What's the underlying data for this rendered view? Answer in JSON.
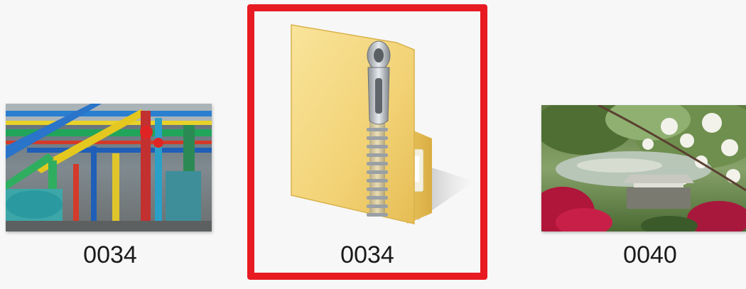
{
  "items": [
    {
      "name": "0034",
      "type": "image",
      "thumbnail": "industrial-pipes-photo"
    },
    {
      "name": "0034",
      "type": "zip-folder",
      "icon": "compressed-folder-icon",
      "selected": true
    },
    {
      "name": "0040",
      "type": "image",
      "thumbnail": "garden-landscape-photo"
    }
  ],
  "colors": {
    "selection_border": "#e81b22",
    "background": "#f7f7f7",
    "folder_yellow": "#f3d57a"
  }
}
